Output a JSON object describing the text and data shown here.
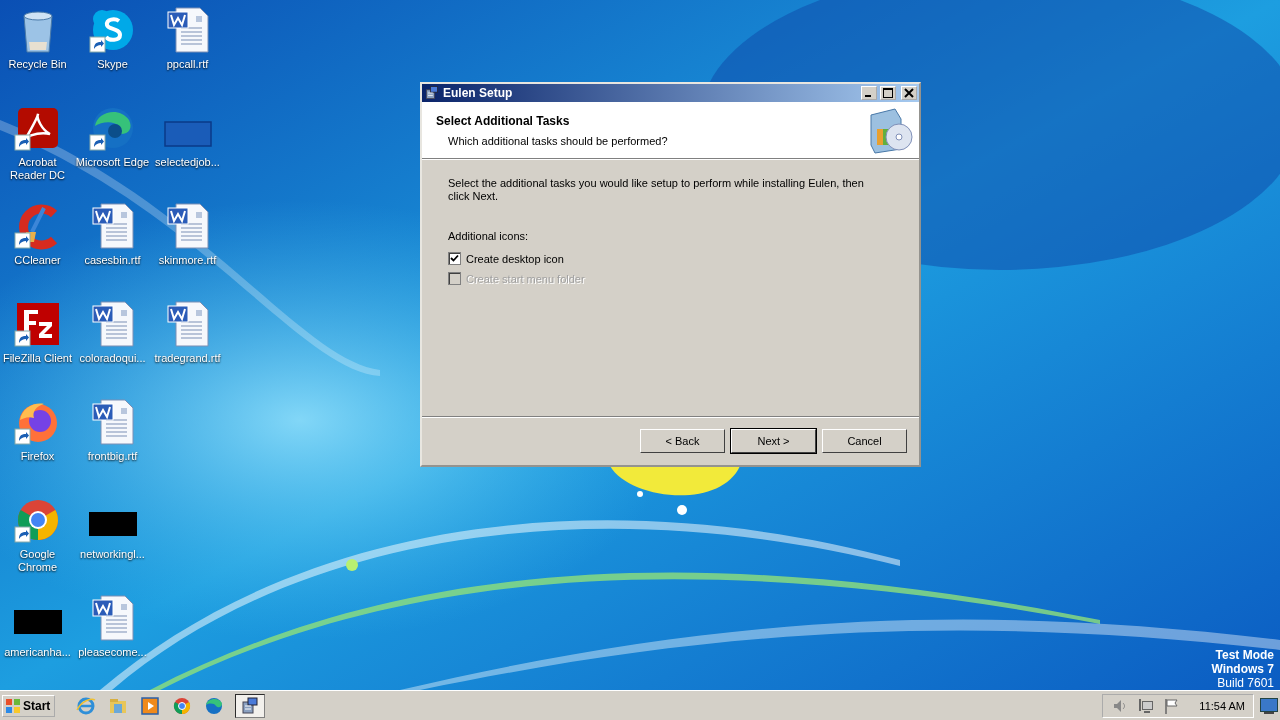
{
  "desktop": {
    "icons": [
      {
        "kind": "recycle-bin",
        "label": "Recycle Bin",
        "shortcut": false
      },
      {
        "kind": "acrobat",
        "label": "Acrobat Reader DC",
        "shortcut": true
      },
      {
        "kind": "ccleaner",
        "label": "CCleaner",
        "shortcut": true
      },
      {
        "kind": "filezilla",
        "label": "FileZilla Client",
        "shortcut": true
      },
      {
        "kind": "firefox",
        "label": "Firefox",
        "shortcut": true
      },
      {
        "kind": "chrome",
        "label": "Google Chrome",
        "shortcut": true
      },
      {
        "kind": "dark-thumbnail",
        "label": "americanha...",
        "shortcut": false
      },
      {
        "kind": "skype",
        "label": "Skype",
        "shortcut": true
      },
      {
        "kind": "edge",
        "label": "Microsoft Edge",
        "shortcut": true
      },
      {
        "kind": "word",
        "label": "casesbin.rtf",
        "shortcut": false
      },
      {
        "kind": "word",
        "label": "coloradoqui...",
        "shortcut": false
      },
      {
        "kind": "word",
        "label": "frontbig.rtf",
        "shortcut": false
      },
      {
        "kind": "dark-thumbnail",
        "label": "networkingl...",
        "shortcut": false
      },
      {
        "kind": "word",
        "label": "pleasecome...",
        "shortcut": false
      },
      {
        "kind": "word",
        "label": "ppcall.rtf",
        "shortcut": false
      },
      {
        "kind": "blank-thumbnail",
        "label": "selectedjob...",
        "shortcut": false
      },
      {
        "kind": "word",
        "label": "skinmore.rtf",
        "shortcut": false
      },
      {
        "kind": "word",
        "label": "tradegrand.rtf",
        "shortcut": false
      }
    ],
    "watermark_lines": [
      "Test Mode",
      "Windows 7",
      "Build 7601"
    ]
  },
  "dialog": {
    "title": "Eulen Setup",
    "heading": "Select Additional Tasks",
    "subheading": "Which additional tasks should be performed?",
    "intro": "Select the additional tasks you would like setup to perform while installing Eulen, then click Next.",
    "group_label": "Additional icons:",
    "tasks": [
      {
        "label": "Create desktop icon",
        "checked": true,
        "disabled": false
      },
      {
        "label": "Create start menu folder",
        "checked": false,
        "disabled": true
      }
    ],
    "buttons": [
      {
        "label": "< Back",
        "default": false
      },
      {
        "label": "Next >",
        "default": true
      },
      {
        "label": "Cancel",
        "default": false
      }
    ]
  },
  "taskbar": {
    "start": "Start",
    "items": [
      {
        "kind": "ie",
        "selected": false
      },
      {
        "kind": "explorer",
        "selected": false
      },
      {
        "kind": "media-player",
        "selected": false
      },
      {
        "kind": "chrome",
        "selected": false
      },
      {
        "kind": "edge",
        "selected": false
      },
      {
        "kind": "setup",
        "selected": true
      }
    ],
    "clock": "11:54 AM"
  }
}
